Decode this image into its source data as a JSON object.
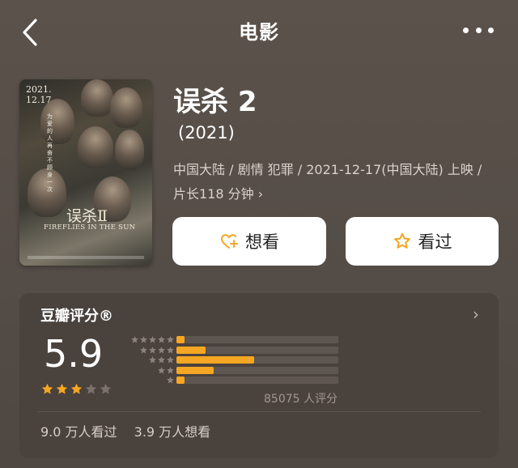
{
  "nav": {
    "title": "电影"
  },
  "poster": {
    "date_line1": "2021.",
    "date_line2": "12.17",
    "name": "误杀Ⅱ",
    "english": "FIREFLIES IN THE SUN",
    "side_text": "为爱的人 再奋不顾身一次"
  },
  "movie": {
    "title": "误杀 2",
    "year": "(2021)",
    "meta": "中国大陆 / 剧情 犯罪 / 2021-12-17(中国大陆) 上映 / 片长118 分钟",
    "meta_chevron": "›"
  },
  "actions": {
    "want_label": "想看",
    "seen_label": "看过"
  },
  "rating": {
    "header": "豆瓣评分®",
    "chevron": "›",
    "score": "5.9",
    "stars_value": 3,
    "stars_max": 5,
    "distribution": [
      {
        "stars": 5,
        "fraction": 0.05
      },
      {
        "stars": 4,
        "fraction": 0.18
      },
      {
        "stars": 3,
        "fraction": 0.48
      },
      {
        "stars": 2,
        "fraction": 0.23
      },
      {
        "stars": 1,
        "fraction": 0.05
      }
    ],
    "count_text": "85075 人评分",
    "watched": "9.0 万人看过",
    "wants": "3.9 万人想看"
  },
  "colors": {
    "accent": "#f5a623",
    "card": "#4a423d",
    "star_empty": "#7a716a"
  }
}
